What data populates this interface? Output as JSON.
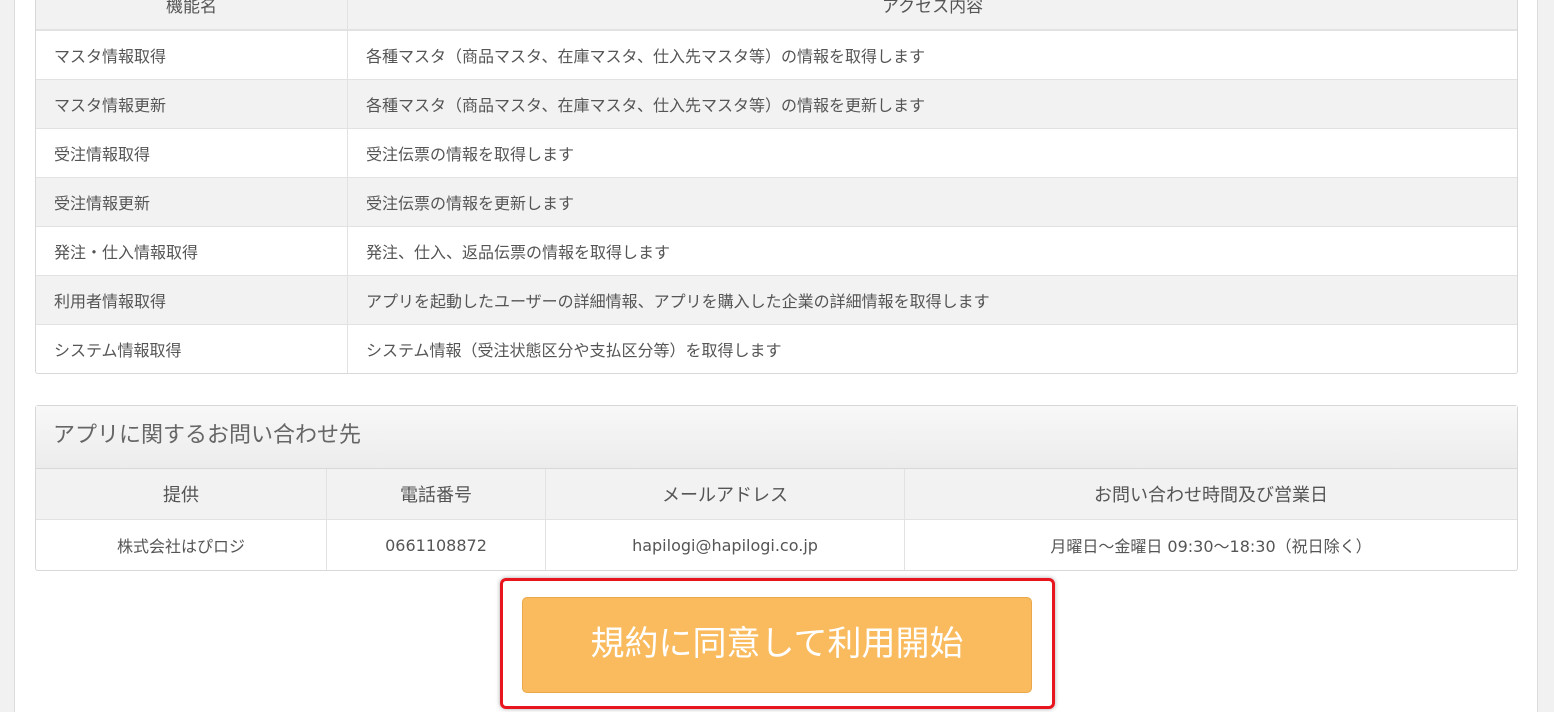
{
  "access_table": {
    "headers": {
      "name": "機能名",
      "content": "アクセス内容"
    },
    "rows": [
      {
        "name": "マスタ情報取得",
        "content": "各種マスタ（商品マスタ、在庫マスタ、仕入先マスタ等）の情報を取得します"
      },
      {
        "name": "マスタ情報更新",
        "content": "各種マスタ（商品マスタ、在庫マスタ、仕入先マスタ等）の情報を更新します"
      },
      {
        "name": "受注情報取得",
        "content": "受注伝票の情報を取得します"
      },
      {
        "name": "受注情報更新",
        "content": "受注伝票の情報を更新します"
      },
      {
        "name": "発注・仕入情報取得",
        "content": "発注、仕入、返品伝票の情報を取得します"
      },
      {
        "name": "利用者情報取得",
        "content": "アプリを起動したユーザーの詳細情報、アプリを購入した企業の詳細情報を取得します"
      },
      {
        "name": "システム情報取得",
        "content": "システム情報（受注状態区分や支払区分等）を取得します"
      }
    ]
  },
  "contact": {
    "title": "アプリに関するお問い合わせ先",
    "headers": {
      "provider": "提供",
      "phone": "電話番号",
      "email": "メールアドレス",
      "hours": "お問い合わせ時間及び営業日"
    },
    "values": {
      "provider": "株式会社はぴロジ",
      "phone": "0661108872",
      "email": "hapilogi@hapilogi.co.jp",
      "hours": "月曜日～金曜日 09:30～18:30（祝日除く）"
    }
  },
  "agree_button": {
    "label": "規約に同意して利用開始"
  },
  "colors": {
    "button_bg": "#f9bb5e",
    "highlight_border": "#e8141e",
    "table_alt_row": "#f2f2f2"
  }
}
